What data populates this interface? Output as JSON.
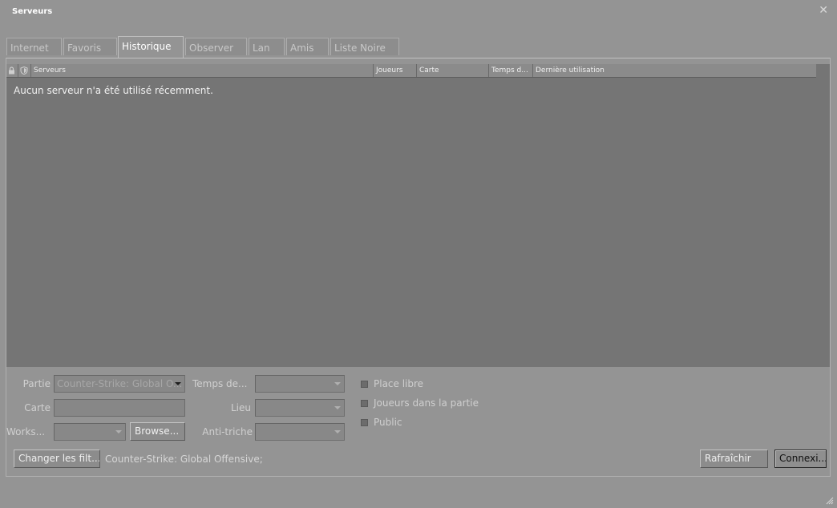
{
  "window": {
    "title": "Serveurs",
    "close_glyph": "✕"
  },
  "tabs": [
    {
      "label": "Internet"
    },
    {
      "label": "Favoris"
    },
    {
      "label": "Historique"
    },
    {
      "label": "Observer"
    },
    {
      "label": "Lan"
    },
    {
      "label": "Amis"
    },
    {
      "label": "Liste Noire"
    }
  ],
  "active_tab": "Historique",
  "table": {
    "icon_columns": [
      "lock-icon",
      "shield-icon"
    ],
    "headers": {
      "servers": "Serveurs",
      "players": "Joueurs",
      "map": "Carte",
      "latency": "Temps d...",
      "last_used": "Dernière utilisation"
    },
    "empty_message": "Aucun serveur n'a été utilisé récemment."
  },
  "filters": {
    "game_label": "Partie",
    "game_value": "Counter-Strike: Global O...",
    "map_label": "Carte",
    "map_value": "",
    "workshop_label": "Works...",
    "workshop_value": "",
    "browse_label": "Browse...",
    "latency_label": "Temps de...",
    "latency_value": "",
    "location_label": "Lieu",
    "location_value": "",
    "anticheat_label": "Anti-triche",
    "anticheat_value": "",
    "checkboxes": {
      "free_slot": {
        "label": "Place libre",
        "checked": false
      },
      "players_in_game": {
        "label": "Joueurs dans la partie",
        "checked": false
      },
      "public": {
        "label": "Public",
        "checked": false
      }
    }
  },
  "footer": {
    "change_filters_label": "Changer les filt...",
    "filter_summary": "Counter-Strike: Global Offensive;",
    "refresh_label": "Rafraîchir",
    "connect_label": "Connexi..."
  },
  "colors": {
    "window_bg": "#949494",
    "list_bg": "#757575",
    "header_bg": "#8b8b8b"
  }
}
